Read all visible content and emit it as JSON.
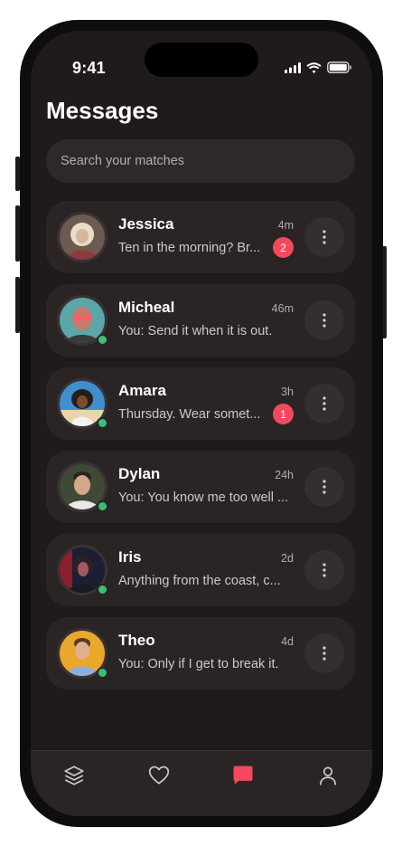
{
  "status_bar": {
    "time": "9:41"
  },
  "header": {
    "title": "Messages"
  },
  "search": {
    "placeholder": "Search your matches"
  },
  "conversations": [
    {
      "name": "Jessica",
      "message": "Ten in the morning? Br...",
      "time": "4m",
      "unread": "2",
      "online": false,
      "avatar_color": "#8a6a55"
    },
    {
      "name": "Micheal",
      "message": "You: Send it when it is out.",
      "time": "46m",
      "unread": "",
      "online": true,
      "avatar_color": "#b84a55"
    },
    {
      "name": "Amara",
      "message": "Thursday. Wear somet...",
      "time": "3h",
      "unread": "1",
      "online": true,
      "avatar_color": "#3a89c6"
    },
    {
      "name": "Dylan",
      "message": "You: You know me too well ...",
      "time": "24h",
      "unread": "",
      "online": true,
      "avatar_color": "#4a5a3a"
    },
    {
      "name": "Iris",
      "message": "Anything from the coast, c...",
      "time": "2d",
      "unread": "",
      "online": true,
      "avatar_color": "#7a1f2f"
    },
    {
      "name": "Theo",
      "message": "You: Only if I get to break it.",
      "time": "4d",
      "unread": "",
      "online": true,
      "avatar_color": "#e3a52a"
    }
  ],
  "tabs": [
    {
      "icon": "layers-icon",
      "active": false
    },
    {
      "icon": "heart-icon",
      "active": false
    },
    {
      "icon": "chat-icon",
      "active": true
    },
    {
      "icon": "profile-icon",
      "active": false
    }
  ],
  "colors": {
    "accent": "#f2495e",
    "online": "#3ac074",
    "background": "#1f1a1b",
    "card": "#2a2425"
  }
}
